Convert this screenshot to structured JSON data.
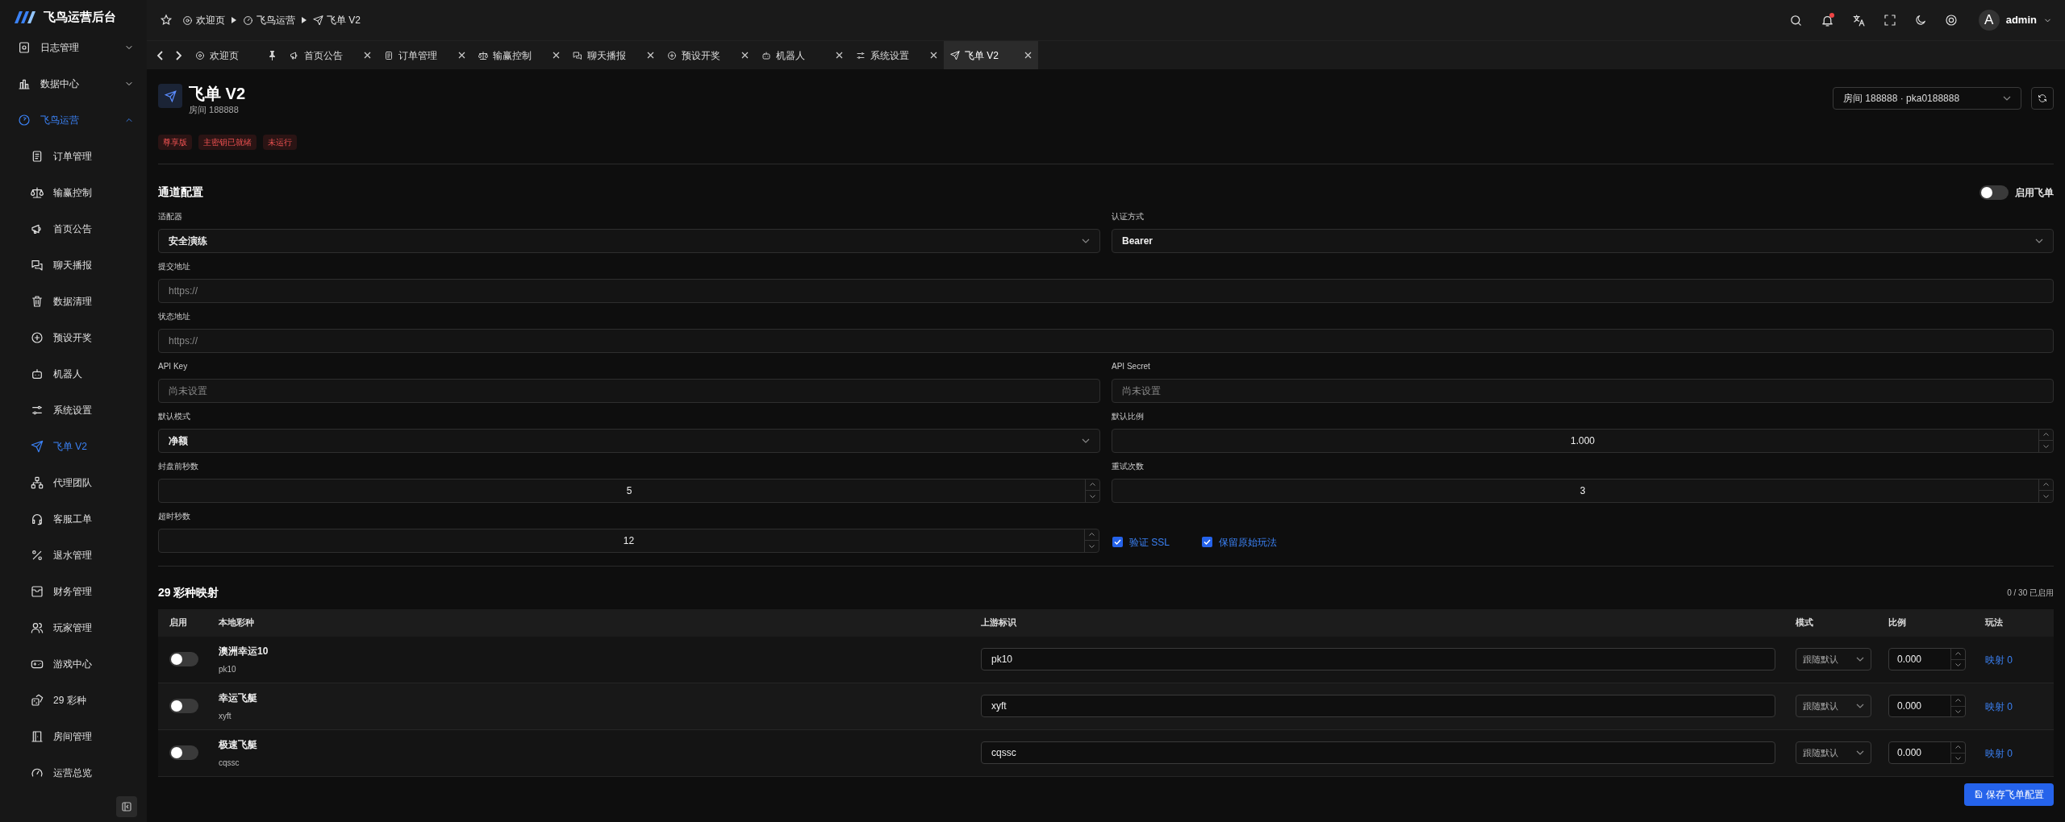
{
  "brand": {
    "title": "飞鸟运营后台"
  },
  "sidebar": {
    "items": [
      {
        "label": "日志管理",
        "expanded": false,
        "selected": false
      },
      {
        "label": "数据中心",
        "expanded": false,
        "selected": false
      },
      {
        "label": "飞鸟运营",
        "expanded": true,
        "selected": true,
        "children": [
          {
            "label": "订单管理",
            "selected": false
          },
          {
            "label": "输赢控制",
            "selected": false
          },
          {
            "label": "首页公告",
            "selected": false
          },
          {
            "label": "聊天播报",
            "selected": false
          },
          {
            "label": "数据清理",
            "selected": false
          },
          {
            "label": "预设开奖",
            "selected": false
          },
          {
            "label": "机器人",
            "selected": false
          },
          {
            "label": "系统设置",
            "selected": false
          },
          {
            "label": "飞单 V2",
            "selected": true
          },
          {
            "label": "代理团队",
            "selected": false
          },
          {
            "label": "客服工单",
            "selected": false
          },
          {
            "label": "退水管理",
            "selected": false
          },
          {
            "label": "财务管理",
            "selected": false
          },
          {
            "label": "玩家管理",
            "selected": false
          },
          {
            "label": "游戏中心",
            "selected": false
          },
          {
            "label": "29 彩种",
            "selected": false
          },
          {
            "label": "房间管理",
            "selected": false
          },
          {
            "label": "运营总览",
            "selected": false
          }
        ]
      }
    ]
  },
  "breadcrumb": [
    "欢迎页",
    "飞鸟运营",
    "飞单 V2"
  ],
  "header": {
    "user": "admin",
    "avatar": "A",
    "notification": true
  },
  "tabs": [
    {
      "label": "欢迎页",
      "pinned": true,
      "selected": false
    },
    {
      "label": "首页公告",
      "pinned": false,
      "selected": false
    },
    {
      "label": "订单管理",
      "pinned": false,
      "selected": false
    },
    {
      "label": "输赢控制",
      "pinned": false,
      "selected": false
    },
    {
      "label": "聊天播报",
      "pinned": false,
      "selected": false
    },
    {
      "label": "预设开奖",
      "pinned": false,
      "selected": false
    },
    {
      "label": "机器人",
      "pinned": false,
      "selected": false
    },
    {
      "label": "系统设置",
      "pinned": false,
      "selected": false
    },
    {
      "label": "飞单 V2",
      "pinned": false,
      "selected": true
    }
  ],
  "page": {
    "title": "飞单 V2",
    "subtitle": "房间 188888",
    "room_select": "房间 188888 · pka0188888",
    "badges": [
      "尊享版",
      "主密钥已就绪",
      "未运行"
    ]
  },
  "channel": {
    "title": "通道配置",
    "enable_label": "启用飞单",
    "enabled": false,
    "rows": [
      [
        {
          "kind": "select",
          "label": "适配器",
          "value": "安全演练"
        },
        {
          "kind": "select",
          "label": "认证方式",
          "value": "Bearer"
        }
      ],
      [
        {
          "kind": "text",
          "label": "提交地址",
          "placeholder": "https://"
        }
      ],
      [
        {
          "kind": "text",
          "label": "状态地址",
          "placeholder": "https://"
        }
      ],
      [
        {
          "kind": "text",
          "label": "API Key",
          "placeholder": "尚未设置"
        },
        {
          "kind": "text",
          "label": "API Secret",
          "placeholder": "尚未设置"
        }
      ],
      [
        {
          "kind": "select",
          "label": "默认模式",
          "value": "净额"
        },
        {
          "kind": "number",
          "label": "默认比例",
          "value": "1.000"
        }
      ],
      [
        {
          "kind": "number",
          "label": "封盘前秒数",
          "value": "5"
        },
        {
          "kind": "number",
          "label": "重试次数",
          "value": "3"
        }
      ],
      [
        {
          "kind": "number",
          "label": "超时秒数",
          "value": "12"
        },
        {
          "kind": "checkboxes",
          "items": [
            {
              "label": "验证 SSL",
              "checked": true
            },
            {
              "label": "保留原始玩法",
              "checked": true
            }
          ]
        }
      ]
    ]
  },
  "mapping": {
    "title": "29 彩种映射",
    "summary": "0 / 30 已启用",
    "columns": [
      "启用",
      "本地彩种",
      "上游标识",
      "模式",
      "比例",
      "玩法"
    ],
    "rows": [
      {
        "enabled": false,
        "name": "澳洲幸运10",
        "code": "pk10",
        "upstream": "pk10",
        "mode": "跟随默认",
        "ratio": "0.000",
        "link": "映射 0"
      },
      {
        "enabled": false,
        "name": "幸运飞艇",
        "code": "xyft",
        "upstream": "xyft",
        "mode": "跟随默认",
        "ratio": "0.000",
        "link": "映射 0"
      },
      {
        "enabled": false,
        "name": "极速飞艇",
        "code": "cqssc",
        "upstream": "cqssc",
        "mode": "跟随默认",
        "ratio": "0.000",
        "link": "映射 0"
      }
    ],
    "save": "保存飞单配置"
  }
}
